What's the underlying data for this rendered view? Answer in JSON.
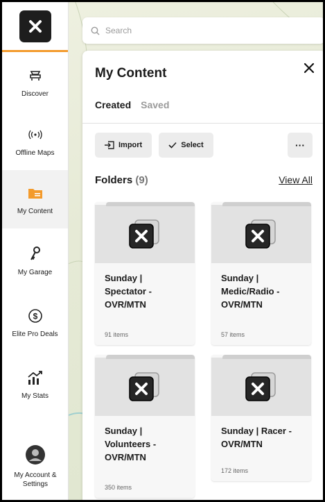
{
  "sidebar": {
    "items": [
      {
        "label": "Discover",
        "icon": "discover-icon"
      },
      {
        "label": "Offline Maps",
        "icon": "offline-maps-icon"
      },
      {
        "label": "My Content",
        "icon": "folder-icon",
        "active": true
      },
      {
        "label": "My Garage",
        "icon": "garage-keys-icon"
      },
      {
        "label": "Elite Pro Deals",
        "icon": "dollar-icon"
      },
      {
        "label": "My Stats",
        "icon": "stats-icon"
      },
      {
        "label": "My Account & Settings",
        "icon": "avatar-icon"
      }
    ]
  },
  "search": {
    "placeholder": "Search"
  },
  "panel": {
    "title": "My Content",
    "tabs": [
      {
        "label": "Created"
      },
      {
        "label": "Saved"
      }
    ],
    "toolbar": {
      "import_label": "Import",
      "select_label": "Select",
      "more_label": "···"
    },
    "folders": {
      "heading": "Folders",
      "count": "(9)",
      "view_all": "View All",
      "cards": [
        {
          "line1": "Sunday |",
          "line2": "Spectator -",
          "line3": "OVR/MTN",
          "items": "91 items"
        },
        {
          "line1": "Sunday |",
          "line2": "Medic/Radio -",
          "line3": "OVR/MTN",
          "items": "57 items"
        },
        {
          "line1": "Sunday |",
          "line2": "Volunteers -",
          "line3": "OVR/MTN",
          "items": "350 items"
        },
        {
          "line1": "Sunday | Racer -",
          "line2": "OVR/MTN",
          "line3": "",
          "items": "172 items"
        }
      ]
    }
  },
  "colors": {
    "accent": "#f39a2b",
    "logo_bg": "#1d1d1d"
  }
}
